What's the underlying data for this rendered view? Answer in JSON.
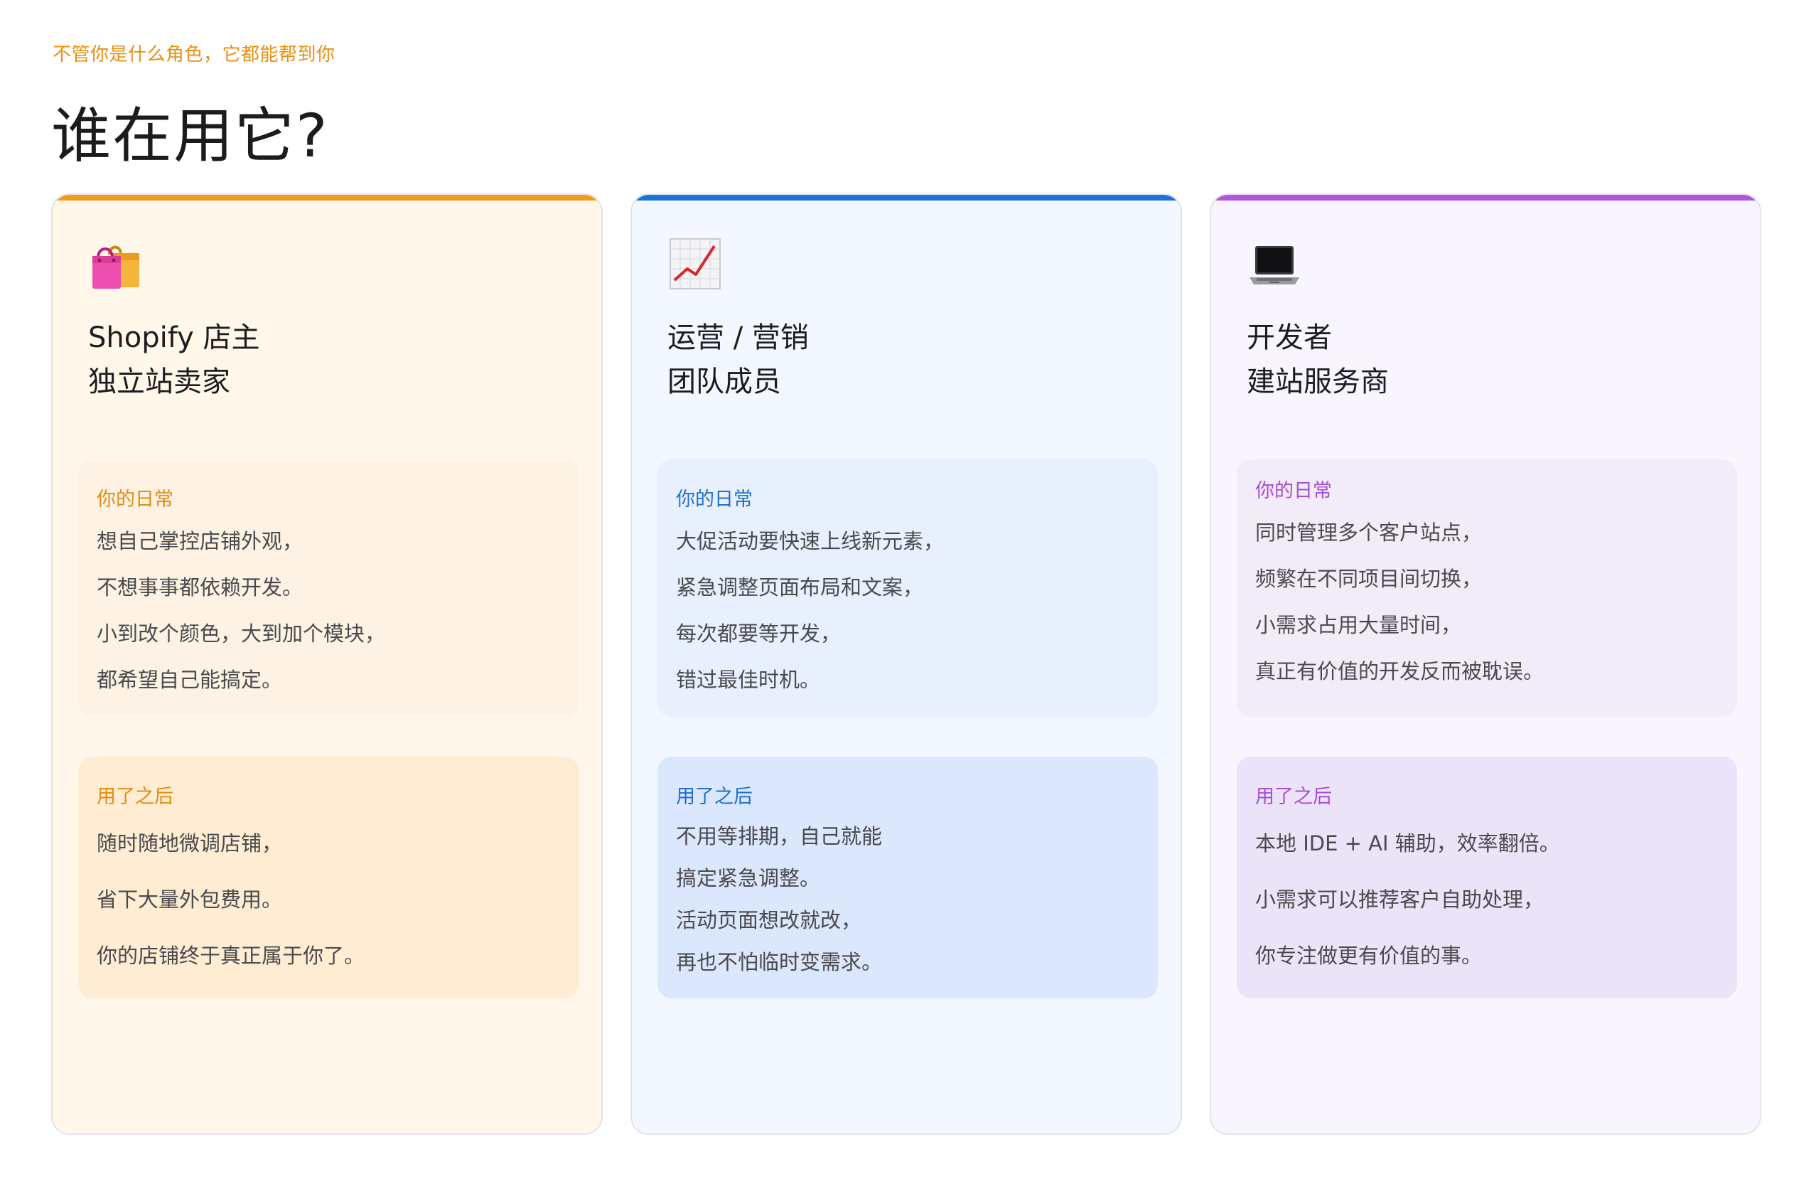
{
  "header": {
    "eyebrow": "不管你是什么角色，它都能帮到你",
    "title": "谁在用它?"
  },
  "colors": {
    "orange": "#f29a1a",
    "blue": "#1a73d9",
    "purple": "#b155e0"
  },
  "cards": [
    {
      "icon": "shopping-bags-icon",
      "title_line1": "Shopify 店主",
      "title_line2": "独立站卖家",
      "daily_title": "你的日常",
      "daily": [
        "想自己掌控店铺外观，",
        "不想事事都依赖开发。",
        "小到改个颜色，大到加个模块，",
        "都希望自己能搞定。"
      ],
      "after_title": "用了之后",
      "after": [
        "随时随地微调店铺，",
        "省下大量外包费用。",
        "你的店铺终于真正属于你了。"
      ]
    },
    {
      "icon": "chart-increasing-icon",
      "title_line1": "运营 / 营销",
      "title_line2": "团队成员",
      "daily_title": "你的日常",
      "daily": [
        "大促活动要快速上线新元素，",
        "紧急调整页面布局和文案，",
        "每次都要等开发，",
        "错过最佳时机。"
      ],
      "after_title": "用了之后",
      "after": [
        "不用等排期，自己就能",
        "搞定紧急调整。",
        "活动页面想改就改，",
        "再也不怕临时变需求。"
      ]
    },
    {
      "icon": "laptop-icon",
      "title_line1": "开发者",
      "title_line2": "建站服务商",
      "daily_title": "你的日常",
      "daily": [
        "同时管理多个客户站点，",
        "频繁在不同项目间切换，",
        "小需求占用大量时间，",
        "真正有价值的开发反而被耽误。"
      ],
      "after_title": "用了之后",
      "after": [
        "本地 IDE + AI 辅助，效率翻倍。",
        "小需求可以推荐客户自助处理，",
        "你专注做更有价值的事。"
      ]
    }
  ]
}
